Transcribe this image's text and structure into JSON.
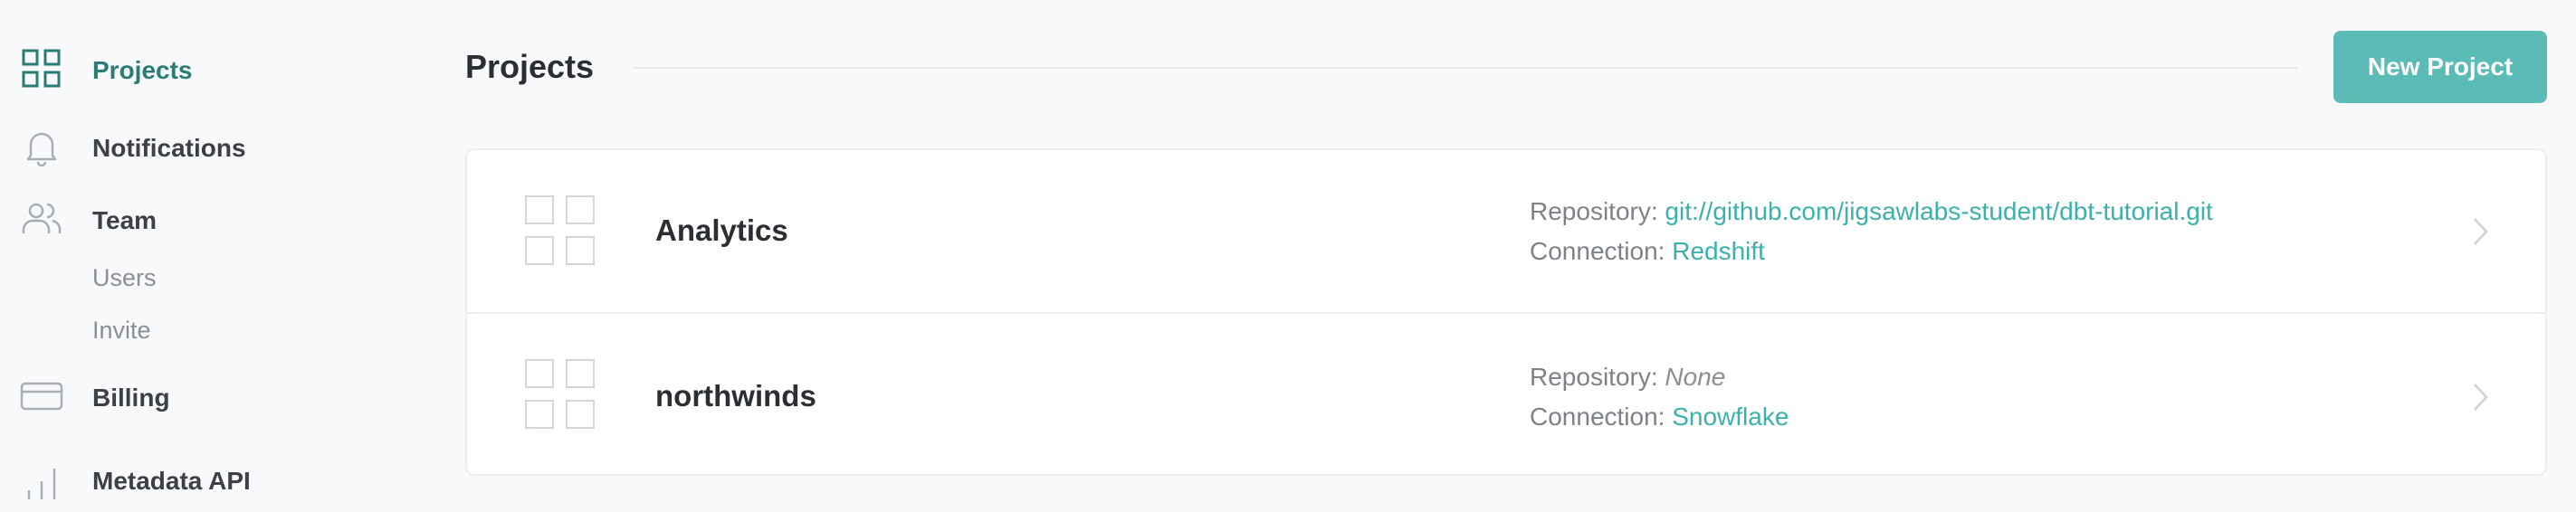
{
  "sidebar": {
    "items": [
      {
        "label": "Projects",
        "icon": "grid-icon",
        "active": true
      },
      {
        "label": "Notifications",
        "icon": "bell-icon"
      },
      {
        "label": "Team",
        "icon": "users-icon"
      },
      {
        "label": "Billing",
        "icon": "credit-card-icon"
      },
      {
        "label": "Metadata API",
        "icon": "bar-chart-icon"
      }
    ],
    "team_subitems": [
      "Users",
      "Invite"
    ]
  },
  "header": {
    "title": "Projects",
    "new_project_label": "New Project"
  },
  "projects": [
    {
      "name": "Analytics",
      "repository_label": "Repository:",
      "repository_value": "git://github.com/jigsawlabs-student/dbt-tutorial.git",
      "connection_label": "Connection:",
      "connection_value": "Redshift"
    },
    {
      "name": "northwinds",
      "repository_label": "Repository:",
      "repository_value": "None",
      "connection_label": "Connection:",
      "connection_value": "Snowflake"
    }
  ],
  "colors": {
    "accent": "#2a7d74",
    "button": "#5bbbb7",
    "link": "#3cb0ab",
    "background": "#f8f9fb"
  }
}
